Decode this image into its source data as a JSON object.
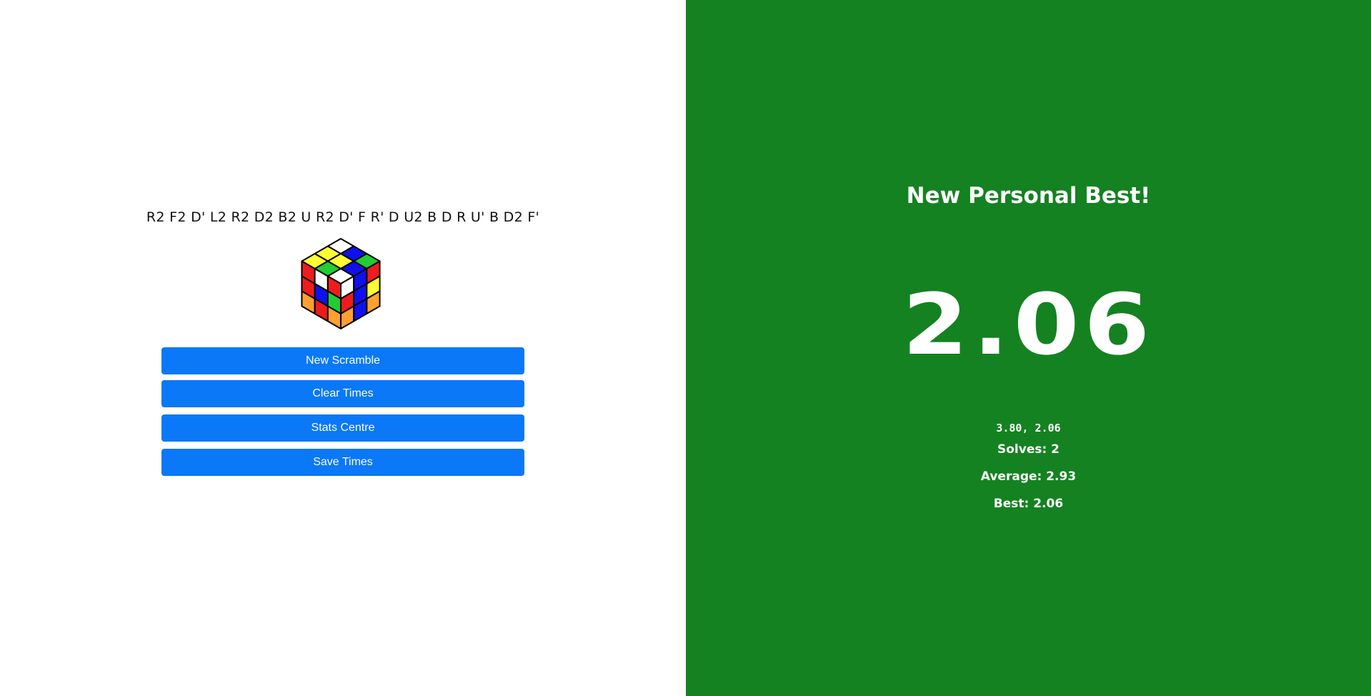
{
  "left": {
    "scramble": "R2 F2 D' L2 R2 D2 B2 U R2 D' F R' D U2 B D R U' B D2 F'",
    "buttons": {
      "new_scramble": "New Scramble",
      "clear_times": "Clear Times",
      "stats_centre": "Stats Centre",
      "save_times": "Save Times"
    },
    "button_color": "#0a78f7"
  },
  "right": {
    "background_color": "#148221",
    "heading": "New Personal Best!",
    "current_time": "2.06",
    "times_list": "3.80, 2.06",
    "solves": "Solves: 2",
    "average": "Average: 2.93",
    "best": "Best: 2.06"
  },
  "cube": {
    "colors": {
      "W": "#ffffff",
      "Y": "#ffff33",
      "R": "#ee1c1c",
      "O": "#ffa030",
      "G": "#22cc33",
      "B": "#1010ee"
    },
    "top": [
      [
        "W",
        "B",
        "G"
      ],
      [
        "Y",
        "Y",
        "B"
      ],
      [
        "Y",
        "G",
        "W"
      ]
    ],
    "left": [
      [
        "R",
        "W",
        "R"
      ],
      [
        "R",
        "B",
        "G"
      ],
      [
        "O",
        "R",
        "O"
      ]
    ],
    "right": [
      [
        "W",
        "B",
        "R"
      ],
      [
        "R",
        "B",
        "Y"
      ],
      [
        "O",
        "B",
        "O"
      ]
    ]
  }
}
